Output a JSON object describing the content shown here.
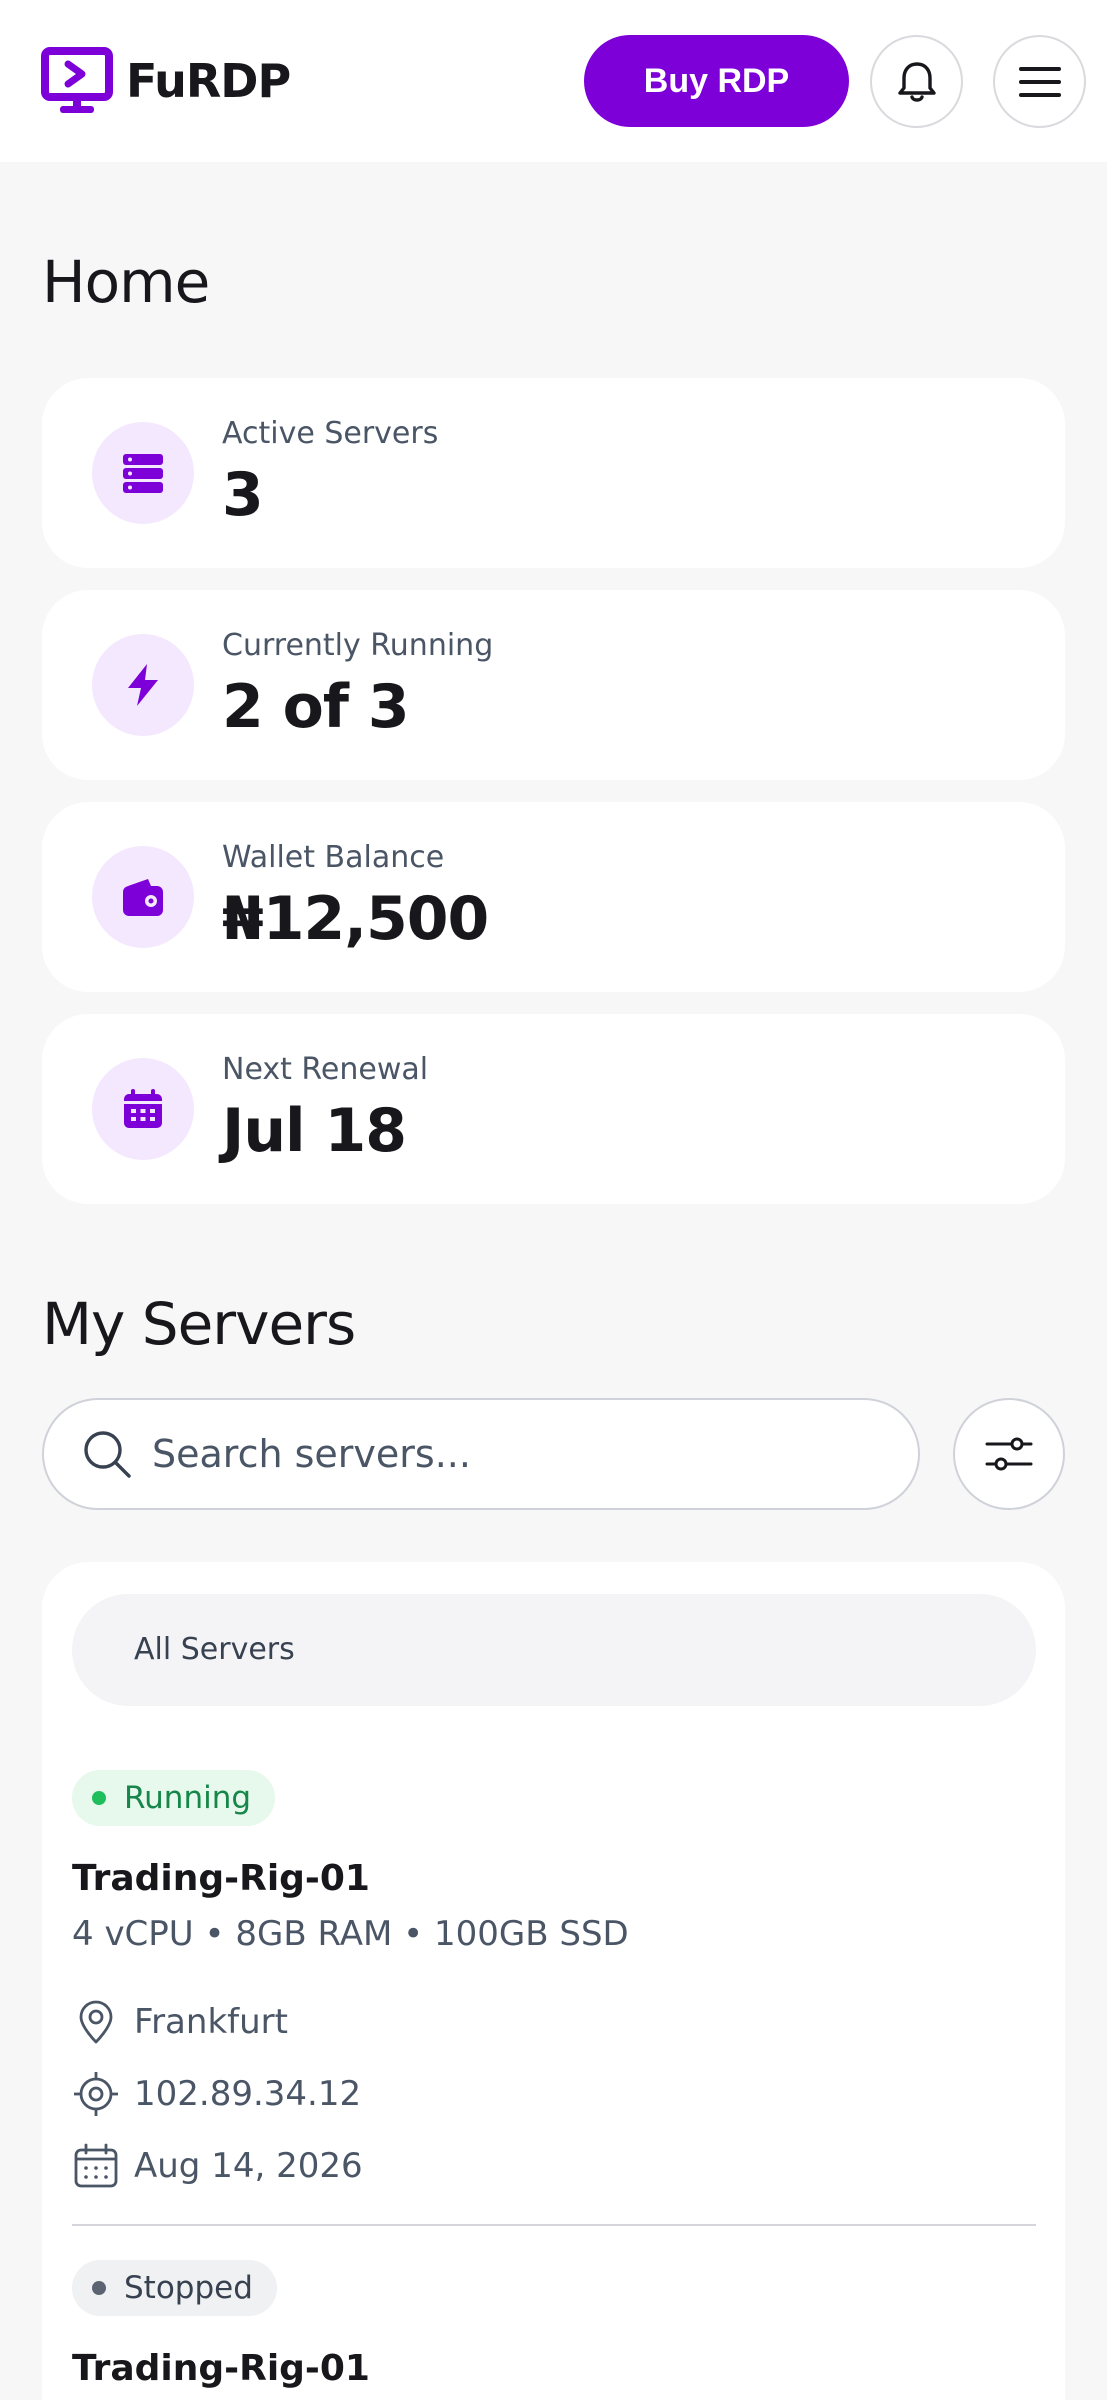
{
  "header": {
    "app_name": "FuRDP",
    "buy_label": "Buy RDP",
    "icons": {
      "logo": "monitor-play-icon",
      "bell": "bell-icon",
      "menu": "hamburger-icon"
    }
  },
  "home": {
    "title": "Home",
    "stats": [
      {
        "label": "Active Servers",
        "value": "3",
        "icon": "server-stack-icon"
      },
      {
        "label": "Currently Running",
        "value": "2 of 3",
        "icon": "lightning-icon"
      },
      {
        "label": "Wallet Balance",
        "value": "₦12,500",
        "icon": "wallet-icon"
      },
      {
        "label": "Next Renewal",
        "value": "Jul 18",
        "icon": "calendar-icon"
      }
    ]
  },
  "servers": {
    "title": "My Servers",
    "search_placeholder": "Search servers...",
    "filter_tab": "All Servers",
    "items": [
      {
        "status": "Running",
        "name": "Trading-Rig-01",
        "spec": "4 vCPU • 8GB RAM • 100GB SSD",
        "location": "Frankfurt",
        "ip": "102.89.34.12",
        "renewal": "Aug 14, 2026"
      },
      {
        "status": "Stopped",
        "name": "Trading-Rig-01"
      }
    ]
  },
  "colors": {
    "brand": "#7d00d8",
    "icon_bg": "#f3e8fd",
    "running": "#1fbe5d",
    "stopped": "#5c6472",
    "page_bg": "#f7f7f8"
  }
}
